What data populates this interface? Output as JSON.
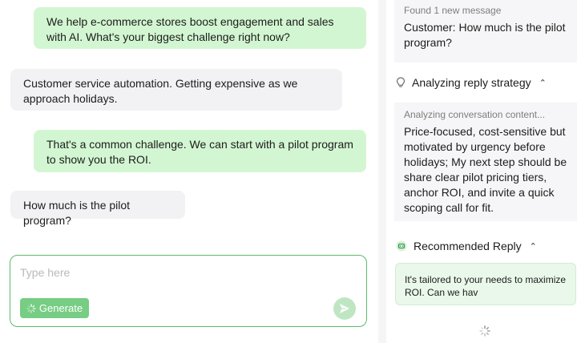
{
  "chat": {
    "messages": [
      {
        "role": "agent",
        "text": "We help e-commerce stores boost engagement and sales with AI. What's your biggest challenge right now?"
      },
      {
        "role": "customer",
        "text": "Customer service automation. Getting expensive as we approach holidays."
      },
      {
        "role": "agent",
        "text": "That's a common challenge. We can start with a pilot program to show you the ROI."
      },
      {
        "role": "customer",
        "text": "How much is the pilot program?"
      }
    ],
    "composer": {
      "placeholder": "Type here",
      "value": "",
      "generate_label": "Generate"
    }
  },
  "panel": {
    "found": {
      "status": "Found 1 new message",
      "message": "Customer: How much is the pilot program?"
    },
    "strategy": {
      "title": "Analyzing reply strategy",
      "status": "Analyzing conversation content...",
      "text": "Price-focused, cost-sensitive but motivated by urgency before holidays; My next step should be share clear pilot pricing tiers, anchor ROI, and invite a quick scoping call for fit."
    },
    "recommended": {
      "title": "Recommended Reply",
      "text": "It's tailored to your needs to maximize ROI. Can we hav"
    }
  },
  "colors": {
    "agent_bubble": "#d3f6d2",
    "customer_bubble": "#f2f2f4",
    "accent": "#5cb96a",
    "generate_button": "#76cd83",
    "reply_card": "#e9f8ea"
  },
  "icons": {
    "strategy": "lightbulb-icon",
    "recommended": "robot-icon",
    "send": "send-icon",
    "generate": "spinner-icon",
    "loading": "spinner-icon",
    "collapse": "chevron-up-icon"
  }
}
